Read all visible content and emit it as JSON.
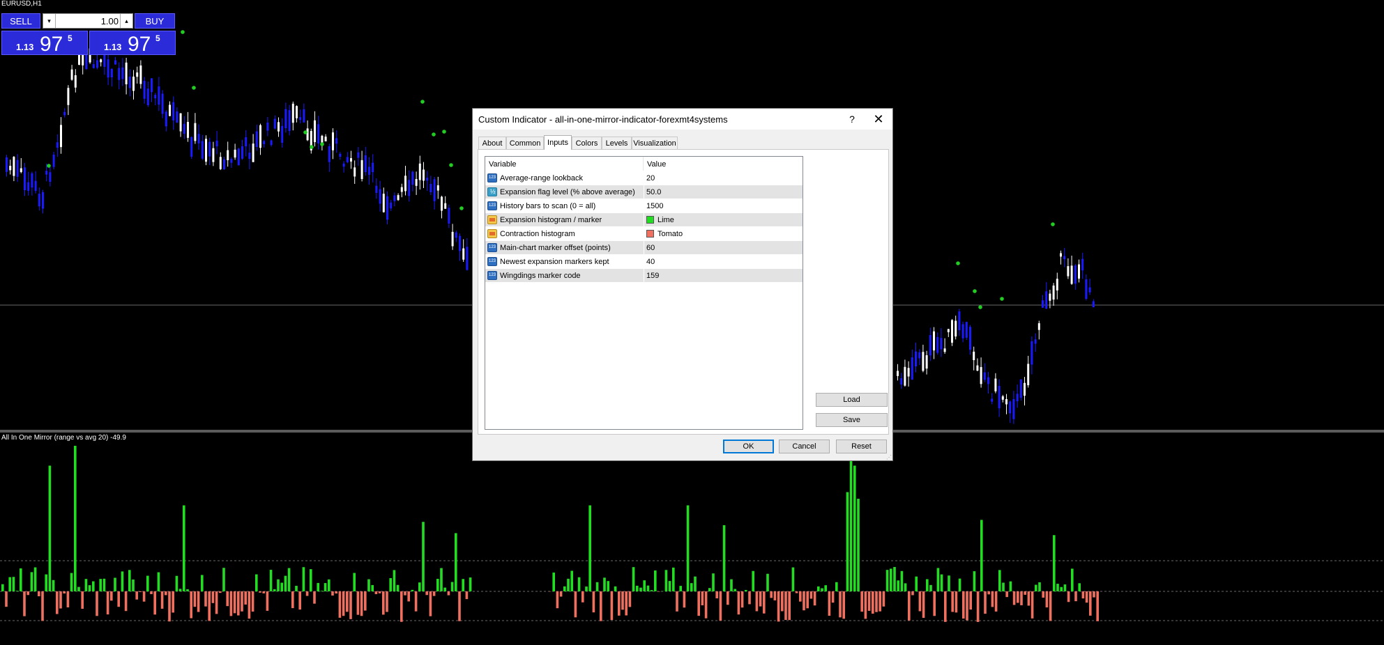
{
  "chart": {
    "symbol_title": "EURUSD,H1",
    "subwindow_title": "All In One Mirror (range vs avg 20) -49.9",
    "colors": {
      "background": "#000000",
      "bull_candle": "#ffffff",
      "bear_candle": "#1a1aff",
      "marker": "#22cc22",
      "expansion": "#22dd22",
      "contraction": "#f07060",
      "grid": "#6a6a6a"
    }
  },
  "trade_panel": {
    "sell_label": "SELL",
    "buy_label": "BUY",
    "lot_value": "1.00",
    "sell_price_small": "1.13",
    "sell_price_big": "97",
    "sell_price_sup": "5",
    "buy_price_small": "1.13",
    "buy_price_big": "97",
    "buy_price_sup": "5"
  },
  "dialog": {
    "title": "Custom Indicator - all-in-one-mirror-indicator-forexmt4systems",
    "help_label": "?",
    "close_label": "✕",
    "tabs": [
      {
        "label": "About",
        "active": false
      },
      {
        "label": "Common",
        "active": false
      },
      {
        "label": "Inputs",
        "active": true
      },
      {
        "label": "Colors",
        "active": false
      },
      {
        "label": "Levels",
        "active": false
      },
      {
        "label": "Visualization",
        "active": false
      }
    ],
    "table": {
      "header_variable": "Variable",
      "header_value": "Value",
      "rows": [
        {
          "variable": "Average-range lookback",
          "value": "20",
          "icon": "int-icon"
        },
        {
          "variable": "Expansion flag level (% above average)",
          "value": "50.0",
          "icon": "double-icon"
        },
        {
          "variable": "History bars to scan (0 = all)",
          "value": "1500",
          "icon": "int-icon"
        },
        {
          "variable": "Expansion histogram / marker",
          "value": "Lime",
          "icon": "color-icon",
          "swatch": "#22dd22"
        },
        {
          "variable": "Contraction histogram",
          "value": "Tomato",
          "icon": "color-icon",
          "swatch": "#f07060"
        },
        {
          "variable": "Main-chart marker offset (points)",
          "value": "60",
          "icon": "int-icon"
        },
        {
          "variable": "Newest expansion markers kept",
          "value": "40",
          "icon": "int-icon"
        },
        {
          "variable": "Wingdings marker code",
          "value": "159",
          "icon": "int-icon"
        }
      ]
    },
    "load_label": "Load",
    "save_label": "Save",
    "ok_label": "OK",
    "cancel_label": "Cancel",
    "reset_label": "Reset"
  }
}
